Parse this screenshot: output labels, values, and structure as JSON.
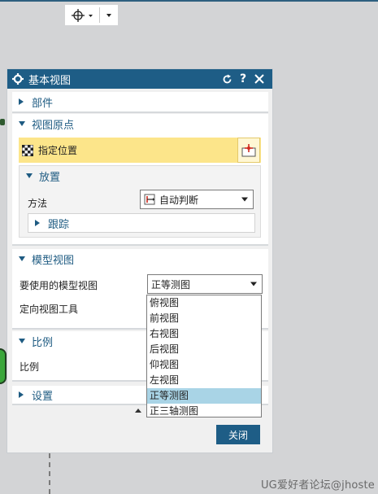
{
  "dialog": {
    "title": "基本视图",
    "sections": {
      "part": {
        "label": "部件",
        "expanded": false
      },
      "view_origin": {
        "label": "视图原点",
        "expanded": true,
        "specify_location_label": "指定位置",
        "placement": {
          "label": "放置",
          "expanded": true,
          "method_label": "方法",
          "method_value": "自动判断",
          "tracking_label": "跟踪"
        }
      },
      "model_view": {
        "label": "模型视图",
        "expanded": true,
        "model_view_label": "要使用的模型视图",
        "model_view_value": "正等测图",
        "orient_tool_label": "定向视图工具",
        "options": [
          "俯视图",
          "前视图",
          "右视图",
          "后视图",
          "仰视图",
          "左视图",
          "正等测图",
          "正三轴测图"
        ],
        "selected_option": "正等测图"
      },
      "scale": {
        "label": "比例",
        "expanded": true,
        "scale_label": "比例"
      },
      "settings": {
        "label": "设置",
        "expanded": false
      }
    },
    "close_label": "关闭"
  },
  "watermark": "UG爱好者论坛@jhoste",
  "colors": {
    "titlebar": "#1e5d86",
    "section_text": "#1e5b82",
    "highlight": "#fce58a",
    "selected_option": "#a9d4e6",
    "background": "#d3d4d6"
  },
  "icons": [
    "crosshair-icon",
    "gear-icon",
    "reset-icon",
    "help-icon",
    "close-icon",
    "checkered-flag-icon",
    "point-pick-icon",
    "method-icon"
  ]
}
